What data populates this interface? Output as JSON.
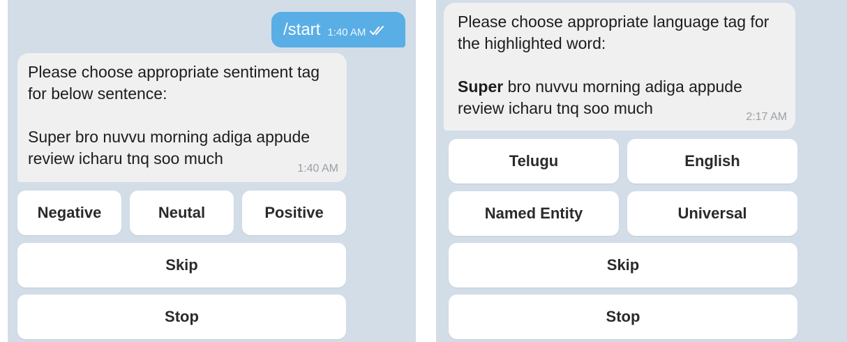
{
  "left": {
    "sent_message": {
      "text": "/start",
      "time": "1:40 AM"
    },
    "received_message": {
      "lines": [
        "Please choose appropriate sentiment tag",
        "for below sentence:"
      ],
      "sentence_lines": [
        "Super bro nuvvu morning adiga appude",
        "review icharu tnq soo much"
      ],
      "time": "1:40 AM"
    },
    "buttons": {
      "negative": "Negative",
      "neutral": "Neutal",
      "positive": "Positive",
      "skip": "Skip",
      "stop": "Stop"
    }
  },
  "right": {
    "received_message": {
      "lines": [
        "Please choose appropriate language tag for",
        "the highlighted word:"
      ],
      "highlighted_word": "Super",
      "sentence_rest": " bro nuvvu morning adiga appude",
      "sentence_line2": "review icharu tnq soo much",
      "time": "2:17 AM"
    },
    "buttons": {
      "telugu": "Telugu",
      "english": "English",
      "named_entity": "Named Entity",
      "universal": "Universal",
      "skip": "Skip",
      "stop": "Stop"
    }
  },
  "colors": {
    "chat_background": "#d2dde8",
    "outgoing_bubble": "#5aaee6",
    "incoming_bubble": "#f0f0f0",
    "button_background": "#ffffff"
  },
  "icons": {
    "read_receipt": "double-check-icon"
  }
}
